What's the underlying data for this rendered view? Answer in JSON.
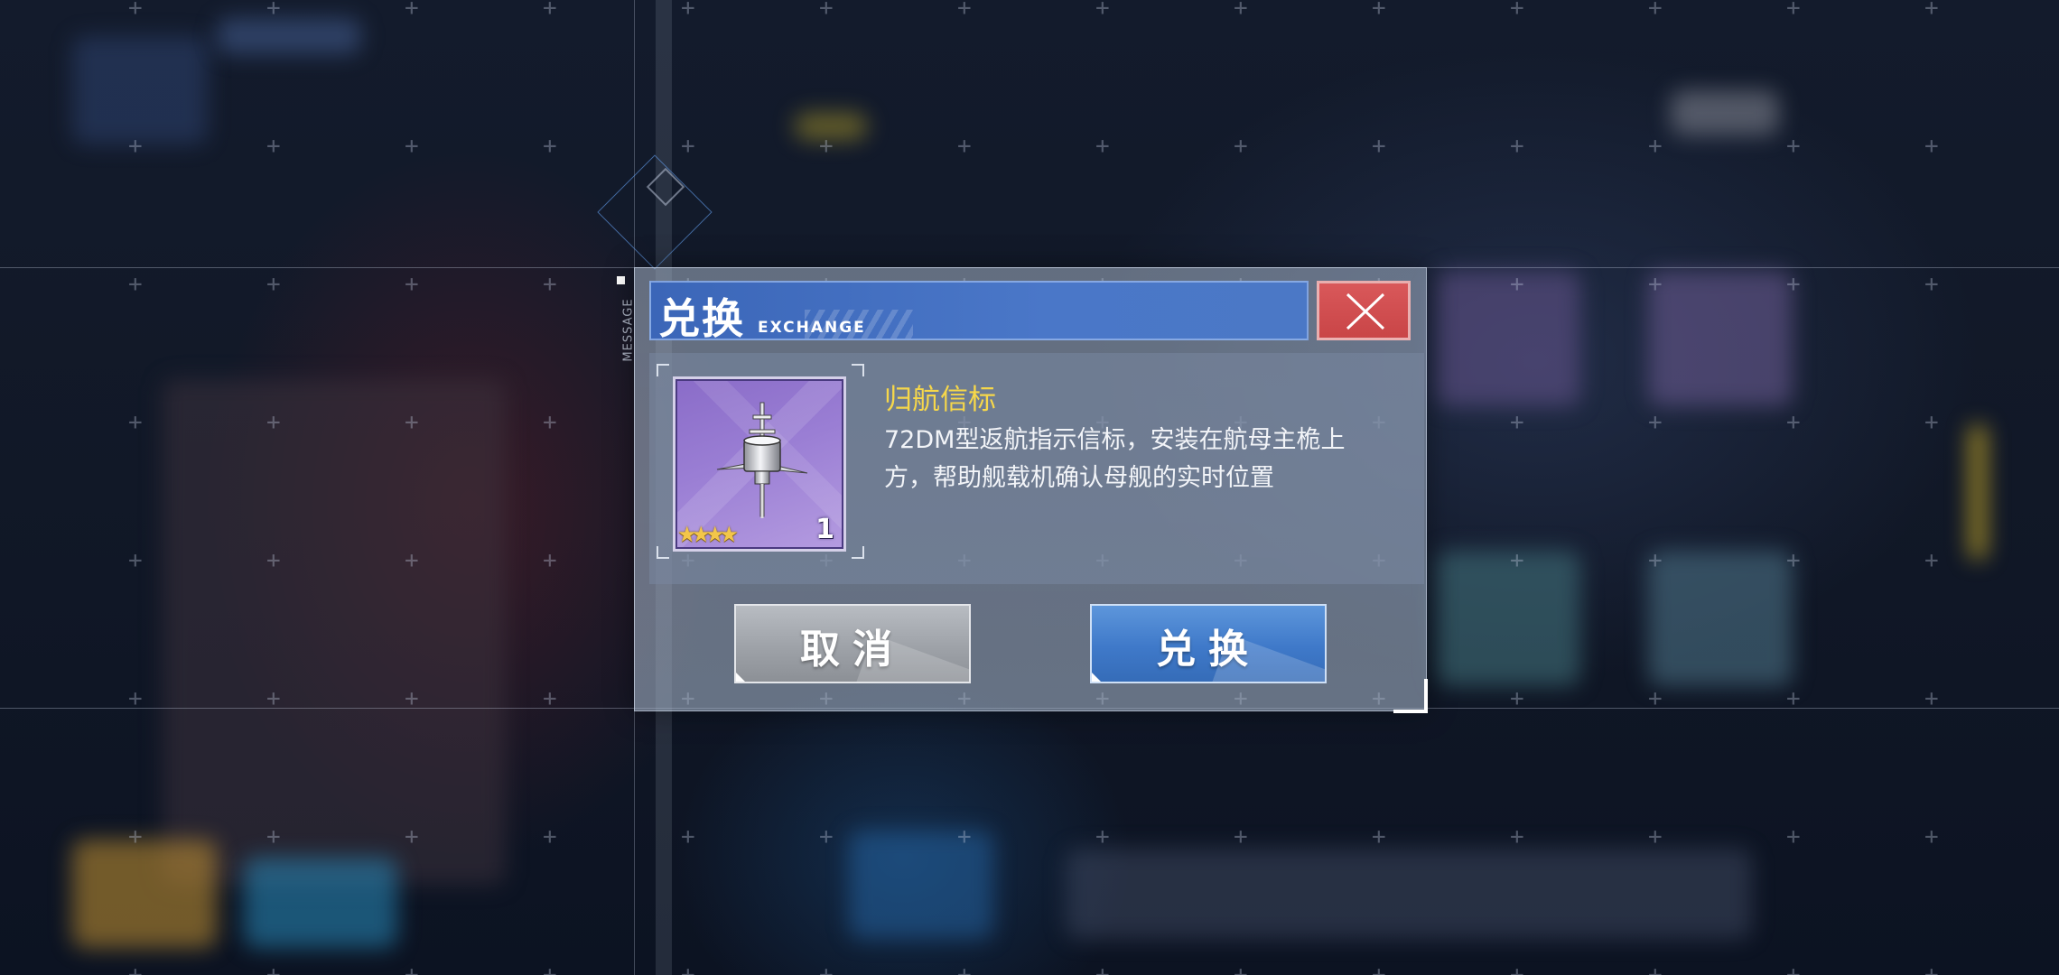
{
  "dialog": {
    "message_tag": "MESSAGE",
    "title_cn": "兑换",
    "title_en": "EXCHANGE",
    "close_icon": "close-icon"
  },
  "item": {
    "name": "归航信标",
    "description": "72DM型返航指示信标，安装在航母主桅上方，帮助舰载机确认母舰的实时位置",
    "stars": "★★★★",
    "star_count": 4,
    "quantity": "1",
    "icon": "beacon-icon"
  },
  "buttons": {
    "cancel_label": "取消",
    "confirm_label": "兑换"
  },
  "colors": {
    "title_bar": "#4a77c8",
    "close_button": "#d9585a",
    "item_name": "#f6d74a",
    "confirm_button": "#3f79c9",
    "cancel_button": "#9ea2a8",
    "item_card": "#9a7ed4"
  }
}
